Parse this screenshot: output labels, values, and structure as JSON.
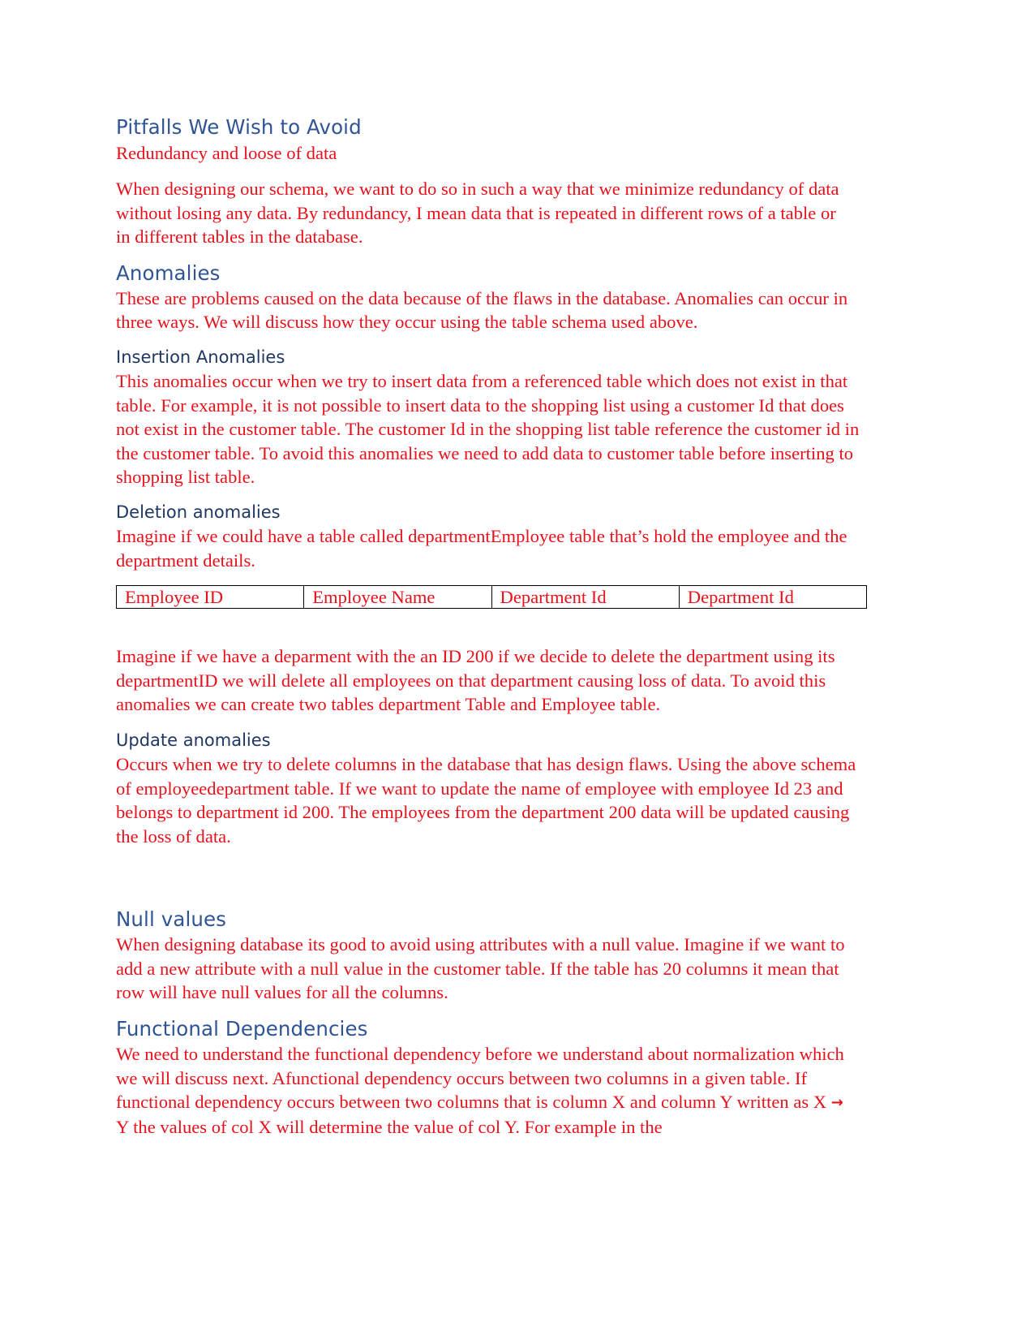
{
  "sections": {
    "pitfalls": {
      "heading": "Pitfalls We Wish to Avoid",
      "subtitle": "Redundancy and loose of data",
      "paragraph": "When designing our schema, we want to do so in such a way that we minimize redundancy of data without losing any data. By redundancy, I mean data that is repeated in different rows of a table or in different tables in the database."
    },
    "anomalies": {
      "heading": "Anomalies",
      "paragraph": "These are problems caused on the data because of the flaws in the database. Anomalies can occur in three ways. We will discuss how they occur using the table schema used above."
    },
    "insertion": {
      "heading": "Insertion Anomalies",
      "paragraph": "This anomalies occur when we try to insert data from a referenced table which does not exist in that table. For example, it is not possible to insert data to the shopping list using a customer Id that does not exist in the customer table. The customer Id in the shopping list table reference the customer id in the customer table. To avoid this anomalies we need to add data to customer table before inserting to shopping list table."
    },
    "deletion": {
      "heading": "Deletion anomalies",
      "paragraph": "Imagine if we could have a table called departmentEmployee table that’s hold the employee and the department details.",
      "table_columns": [
        "Employee ID",
        "Employee Name",
        "Department Id",
        "Department Id"
      ],
      "paragraph_after": "Imagine if we have a deparment with the an ID 200 if we decide to delete the department using its departmentID we will delete all employees on that department causing loss of data. To avoid this anomalies we can create two tables department Table and Employee table."
    },
    "update": {
      "heading": "Update anomalies",
      "paragraph": "Occurs when we try to delete columns in the database that has design flaws. Using the above schema of employeedepartment table. If we want to update the name of employee with employee Id 23 and belongs to department id 200. The employees from the department 200 data will be updated causing the loss of data."
    },
    "null_values": {
      "heading": "Null values",
      "paragraph": "When designing database its good to avoid using attributes with a null value. Imagine if we want to add a new attribute with a null value in the customer table. If the table has 20 columns it mean that row will have null values for all the columns."
    },
    "functional": {
      "heading": "Functional Dependencies",
      "paragraph_part1": "We need to understand the functional dependency before we understand about normalization which we will discuss next. Afunctional dependency occurs between two columns in a given table. If functional dependency occurs between two columns that is column X and column Y written as X ",
      "arrow_glyph": "→",
      "paragraph_part2": " Y the values of col X will determine the value of col Y. For example in the"
    }
  },
  "colors": {
    "heading1": "#2f5496",
    "heading2": "#1f3763",
    "body_text": "#e8101a",
    "table_border": "#000000"
  }
}
